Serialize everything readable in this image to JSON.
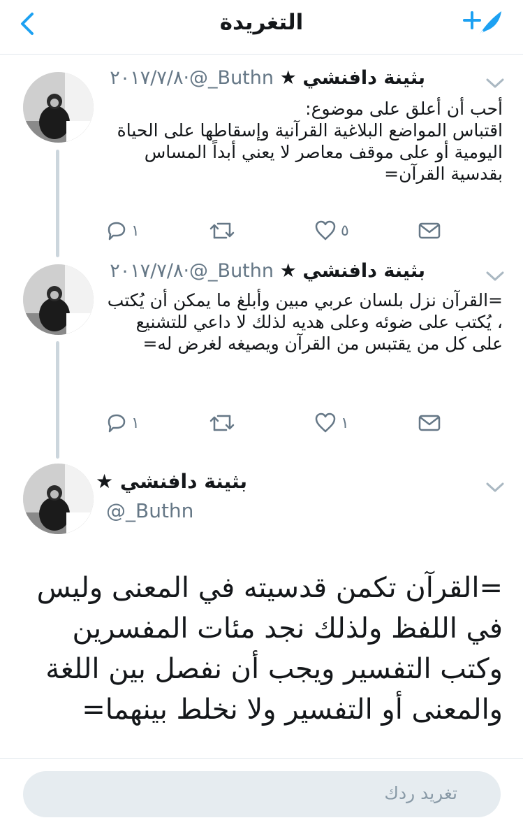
{
  "header": {
    "title": "التغريدة",
    "back_icon": "chevron-left-icon",
    "compose_icon": "compose-tweet-icon",
    "accent_color": "#1da1f2"
  },
  "tweets": [
    {
      "name": "بثينة دافنشي",
      "star": "★",
      "handle": "@_Buthn",
      "separator": "·",
      "date": "٢٠١٧/٧/٨",
      "text": "أحب أن أعلق على موضوع:\nاقتباس المواضع البلاغية القرآنية وإسقاطها على الحياة اليومية أو على موقف معاصر لا يعني أبداً المساس بقدسية القرآن=",
      "replies": "١",
      "retweets": "",
      "likes": "٥"
    },
    {
      "name": "بثينة دافنشي",
      "star": "★",
      "handle": "@_Buthn",
      "separator": "·",
      "date": "٢٠١٧/٧/٨",
      "text": "=القرآن نزل بلسان عربي مبين وأبلغ ما يمكن أن يُكتب ، يُكتب على ضوئه وعلى هديه لذلك لا داعي للتشنيع على كل من يقتبس من القرآن ويصيغه لغرض له=",
      "replies": "١",
      "retweets": "",
      "likes": "١"
    }
  ],
  "focused_tweet": {
    "name": "بثينة دافنشي",
    "star": "★",
    "handle": "@_Buthn",
    "text": "=القرآن تكمن قدسيته في المعنى وليس في اللفظ ولذلك نجد مئات المفسرين وكتب التفسير ويجب أن نفصل بين اللغة والمعنى أو التفسير ولا نخلط بينهما="
  },
  "reply": {
    "placeholder": "تغريد ردك"
  }
}
